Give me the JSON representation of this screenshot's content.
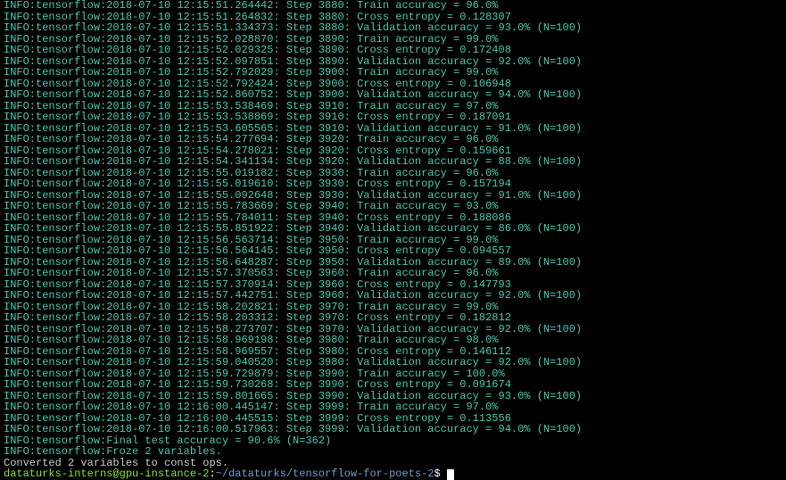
{
  "lines": [
    "INFO:tensorflow:2018-07-10 12:15:51.264442: Step 3880: Train accuracy = 96.0%",
    "INFO:tensorflow:2018-07-10 12:15:51.264832: Step 3880: Cross entropy = 0.128307",
    "INFO:tensorflow:2018-07-10 12:15:51.334373: Step 3880: Validation accuracy = 93.0% (N=100)",
    "INFO:tensorflow:2018-07-10 12:15:52.028870: Step 3890: Train accuracy = 99.0%",
    "INFO:tensorflow:2018-07-10 12:15:52.029325: Step 3890: Cross entropy = 0.172408",
    "INFO:tensorflow:2018-07-10 12:15:52.097851: Step 3890: Validation accuracy = 92.0% (N=100)",
    "INFO:tensorflow:2018-07-10 12:15:52.792029: Step 3900: Train accuracy = 99.0%",
    "INFO:tensorflow:2018-07-10 12:15:52.792424: Step 3900: Cross entropy = 0.106948",
    "INFO:tensorflow:2018-07-10 12:15:52.860752: Step 3900: Validation accuracy = 94.0% (N=100)",
    "INFO:tensorflow:2018-07-10 12:15:53.538469: Step 3910: Train accuracy = 97.0%",
    "INFO:tensorflow:2018-07-10 12:15:53.538869: Step 3910: Cross entropy = 0.187091",
    "INFO:tensorflow:2018-07-10 12:15:53.605565: Step 3910: Validation accuracy = 91.0% (N=100)",
    "INFO:tensorflow:2018-07-10 12:15:54.277694: Step 3920: Train accuracy = 96.0%",
    "INFO:tensorflow:2018-07-10 12:15:54.278021: Step 3920: Cross entropy = 0.159661",
    "INFO:tensorflow:2018-07-10 12:15:54.341134: Step 3920: Validation accuracy = 88.0% (N=100)",
    "INFO:tensorflow:2018-07-10 12:15:55.019182: Step 3930: Train accuracy = 96.0%",
    "INFO:tensorflow:2018-07-10 12:15:55.019610: Step 3930: Cross entropy = 0.157194",
    "INFO:tensorflow:2018-07-10 12:15:55.092648: Step 3930: Validation accuracy = 91.0% (N=100)",
    "INFO:tensorflow:2018-07-10 12:15:55.783669: Step 3940: Train accuracy = 93.0%",
    "INFO:tensorflow:2018-07-10 12:15:55.784011: Step 3940: Cross entropy = 0.188086",
    "INFO:tensorflow:2018-07-10 12:15:55.851922: Step 3940: Validation accuracy = 86.0% (N=100)",
    "INFO:tensorflow:2018-07-10 12:15:56.563714: Step 3950: Train accuracy = 99.0%",
    "INFO:tensorflow:2018-07-10 12:15:56.564145: Step 3950: Cross entropy = 0.094557",
    "INFO:tensorflow:2018-07-10 12:15:56.648287: Step 3950: Validation accuracy = 89.0% (N=100)",
    "INFO:tensorflow:2018-07-10 12:15:57.370563: Step 3960: Train accuracy = 96.0%",
    "INFO:tensorflow:2018-07-10 12:15:57.370914: Step 3960: Cross entropy = 0.147793",
    "INFO:tensorflow:2018-07-10 12:15:57.442751: Step 3960: Validation accuracy = 92.0% (N=100)",
    "INFO:tensorflow:2018-07-10 12:15:58.202821: Step 3970: Train accuracy = 99.0%",
    "INFO:tensorflow:2018-07-10 12:15:58.203312: Step 3970: Cross entropy = 0.182812",
    "INFO:tensorflow:2018-07-10 12:15:58.273707: Step 3970: Validation accuracy = 92.0% (N=100)",
    "INFO:tensorflow:2018-07-10 12:15:58.969198: Step 3980: Train accuracy = 98.0%",
    "INFO:tensorflow:2018-07-10 12:15:58.969557: Step 3980: Cross entropy = 0.146112",
    "INFO:tensorflow:2018-07-10 12:15:59.040520: Step 3980: Validation accuracy = 92.0% (N=100)",
    "INFO:tensorflow:2018-07-10 12:15:59.729879: Step 3990: Train accuracy = 100.0%",
    "INFO:tensorflow:2018-07-10 12:15:59.730268: Step 3990: Cross entropy = 0.091674",
    "INFO:tensorflow:2018-07-10 12:15:59.801665: Step 3990: Validation accuracy = 93.0% (N=100)",
    "INFO:tensorflow:2018-07-10 12:16:00.445147: Step 3999: Train accuracy = 97.0%",
    "INFO:tensorflow:2018-07-10 12:16:00.445515: Step 3999: Cross entropy = 0.113556",
    "INFO:tensorflow:2018-07-10 12:16:00.517963: Step 3999: Validation accuracy = 94.0% (N=100)",
    "INFO:tensorflow:Final test accuracy = 90.6% (N=362)",
    "INFO:tensorflow:Froze 2 variables."
  ],
  "white_line": "Converted 2 variables to const ops.",
  "prompt": {
    "user_host": "dataturks-interns@gpu-instance-2",
    "path": "~/dataturks/tensorflow-for-poets-2",
    "dollar": "$"
  }
}
